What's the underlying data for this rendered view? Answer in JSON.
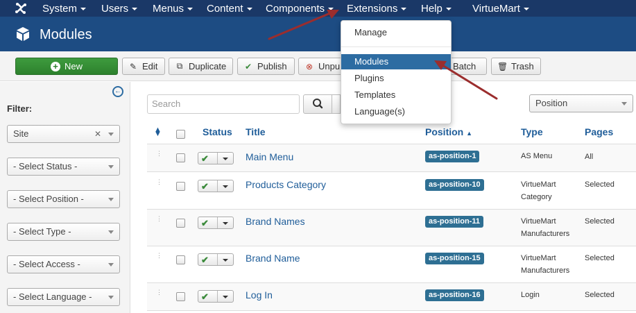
{
  "nav": {
    "items": [
      {
        "label": "System"
      },
      {
        "label": "Users"
      },
      {
        "label": "Menus"
      },
      {
        "label": "Content"
      },
      {
        "label": "Components"
      },
      {
        "label": "Extensions"
      },
      {
        "label": "Help"
      },
      {
        "label": "VirtueMart"
      }
    ]
  },
  "header": {
    "title": "Modules"
  },
  "toolbar": {
    "new": "New",
    "edit": "Edit",
    "duplicate": "Duplicate",
    "publish": "Publish",
    "unpublish": "Unpu",
    "batch": "Batch",
    "trash": "Trash"
  },
  "extensions_menu": {
    "items": [
      {
        "label": "Manage"
      },
      {
        "label": "Modules"
      },
      {
        "label": "Plugins"
      },
      {
        "label": "Templates"
      },
      {
        "label": "Language(s)"
      }
    ],
    "active": "Modules"
  },
  "sidebar": {
    "filter_label": "Filter:",
    "filters": [
      {
        "label": "Site"
      },
      {
        "label": "- Select Status -"
      },
      {
        "label": "- Select Position -"
      },
      {
        "label": "- Select Type -"
      },
      {
        "label": "- Select Access -"
      },
      {
        "label": "- Select Language -"
      }
    ]
  },
  "search": {
    "placeholder": "Search"
  },
  "position_select": "Position",
  "table": {
    "headers": {
      "status": "Status",
      "title": "Title",
      "position": "Position",
      "type": "Type",
      "pages": "Pages"
    },
    "rows": [
      {
        "title": "Main Menu",
        "position": "as-position-1",
        "type_line1": "AS Menu",
        "type_line2": "",
        "pages": "All"
      },
      {
        "title": "Products Category",
        "position": "as-position-10",
        "type_line1": "VirtueMart",
        "type_line2": "Category",
        "pages": "Selected"
      },
      {
        "title": "Brand Names",
        "position": "as-position-11",
        "type_line1": "VirtueMart",
        "type_line2": "Manufacturers",
        "pages": "Selected"
      },
      {
        "title": "Brand Name",
        "position": "as-position-15",
        "type_line1": "VirtueMart",
        "type_line2": "Manufacturers",
        "pages": "Selected"
      },
      {
        "title": "Log In",
        "position": "as-position-16",
        "type_line1": "Login",
        "type_line2": "",
        "pages": "Selected"
      }
    ]
  },
  "colors": {
    "nav_bg": "#1a3867",
    "header_bg": "#1d4c83",
    "accent": "#2d6ca2",
    "badge": "#2e6f93",
    "new_button": "#2d812d",
    "annotation_arrow": "#9b2d2d"
  }
}
